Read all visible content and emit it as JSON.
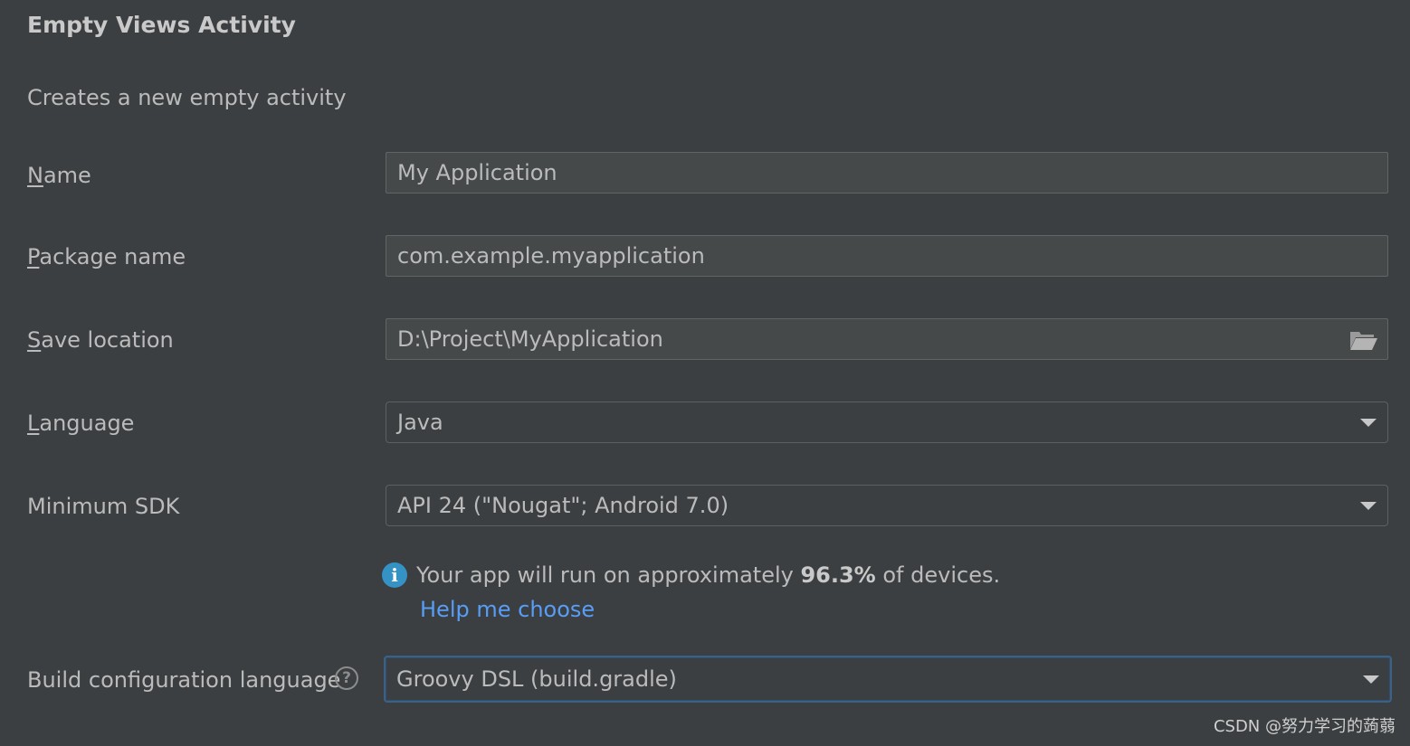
{
  "header": {
    "title": "Empty Views Activity",
    "description": "Creates a new empty activity"
  },
  "form": {
    "name": {
      "label_mnemonic": "N",
      "label_rest": "ame",
      "value": "My Application"
    },
    "package_name": {
      "label_mnemonic": "P",
      "label_rest": "ackage name",
      "value": "com.example.myapplication"
    },
    "save_location": {
      "label_mnemonic": "S",
      "label_rest": "ave location",
      "value": "D:\\Project\\MyApplication",
      "icon": "folder-open-icon"
    },
    "language": {
      "label_mnemonic": "L",
      "label_rest": "anguage",
      "value": "Java"
    },
    "minimum_sdk": {
      "label": "Minimum SDK",
      "value": "API 24 (\"Nougat\"; Android 7.0)"
    },
    "sdk_info": {
      "prefix": "Your app will run on approximately ",
      "percent": "96.3%",
      "suffix": " of devices.",
      "link": "Help me choose",
      "icon": "info-icon"
    },
    "build_config": {
      "label": "Build configuration language",
      "value": "Groovy DSL (build.gradle)",
      "help_glyph": "?"
    }
  },
  "watermark": "CSDN @努力学习的蒟蒻",
  "colors": {
    "background": "#3c3f41",
    "text": "#bbbbbb",
    "link": "#589df6",
    "info": "#3592c4",
    "focus_border": "#3d6185"
  }
}
